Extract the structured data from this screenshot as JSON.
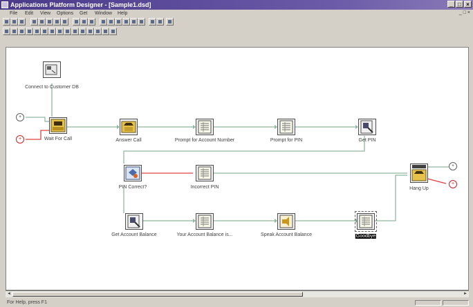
{
  "window": {
    "title": "Applications Platform Designer - [Sample1.dsd]"
  },
  "menu": [
    "File",
    "Edit",
    "View",
    "Options",
    "Get",
    "Window",
    "Help"
  ],
  "status": {
    "text": "For Help, press F1"
  },
  "flow": {
    "nodes": [
      {
        "id": "connect",
        "label": "Connect to Customer DB",
        "icon": "database-connect-icon"
      },
      {
        "id": "wait",
        "label": "Wait For Call",
        "icon": "phone-wait-icon"
      },
      {
        "id": "answer",
        "label": "Answer Call",
        "icon": "phone-answer-icon"
      },
      {
        "id": "prompt_acct",
        "label": "Prompt for Account Number",
        "icon": "prompt-icon"
      },
      {
        "id": "prompt_pin",
        "label": "Prompt for PIN",
        "icon": "prompt-icon"
      },
      {
        "id": "get_pin",
        "label": "Get PIN",
        "icon": "get-data-icon"
      },
      {
        "id": "pin_correct",
        "label": "PIN Correct?",
        "icon": "decision-icon"
      },
      {
        "id": "incorrect_pin",
        "label": "Incorrect PIN",
        "icon": "prompt-icon"
      },
      {
        "id": "hangup",
        "label": "Hang Up",
        "icon": "phone-hangup-icon"
      },
      {
        "id": "get_balance",
        "label": "Get Account Balance",
        "icon": "get-data-icon"
      },
      {
        "id": "your_balance",
        "label": "Your Account Balance is...",
        "icon": "prompt-icon"
      },
      {
        "id": "speak_balance",
        "label": "Speak Account Balance",
        "icon": "speak-icon"
      },
      {
        "id": "goodbye",
        "label": "Goodbye",
        "icon": "prompt-icon",
        "selected": true
      }
    ]
  },
  "colors": {
    "connector": "#8fb8a0",
    "fail_connector": "#e04040",
    "canvas": "#ffffff"
  }
}
